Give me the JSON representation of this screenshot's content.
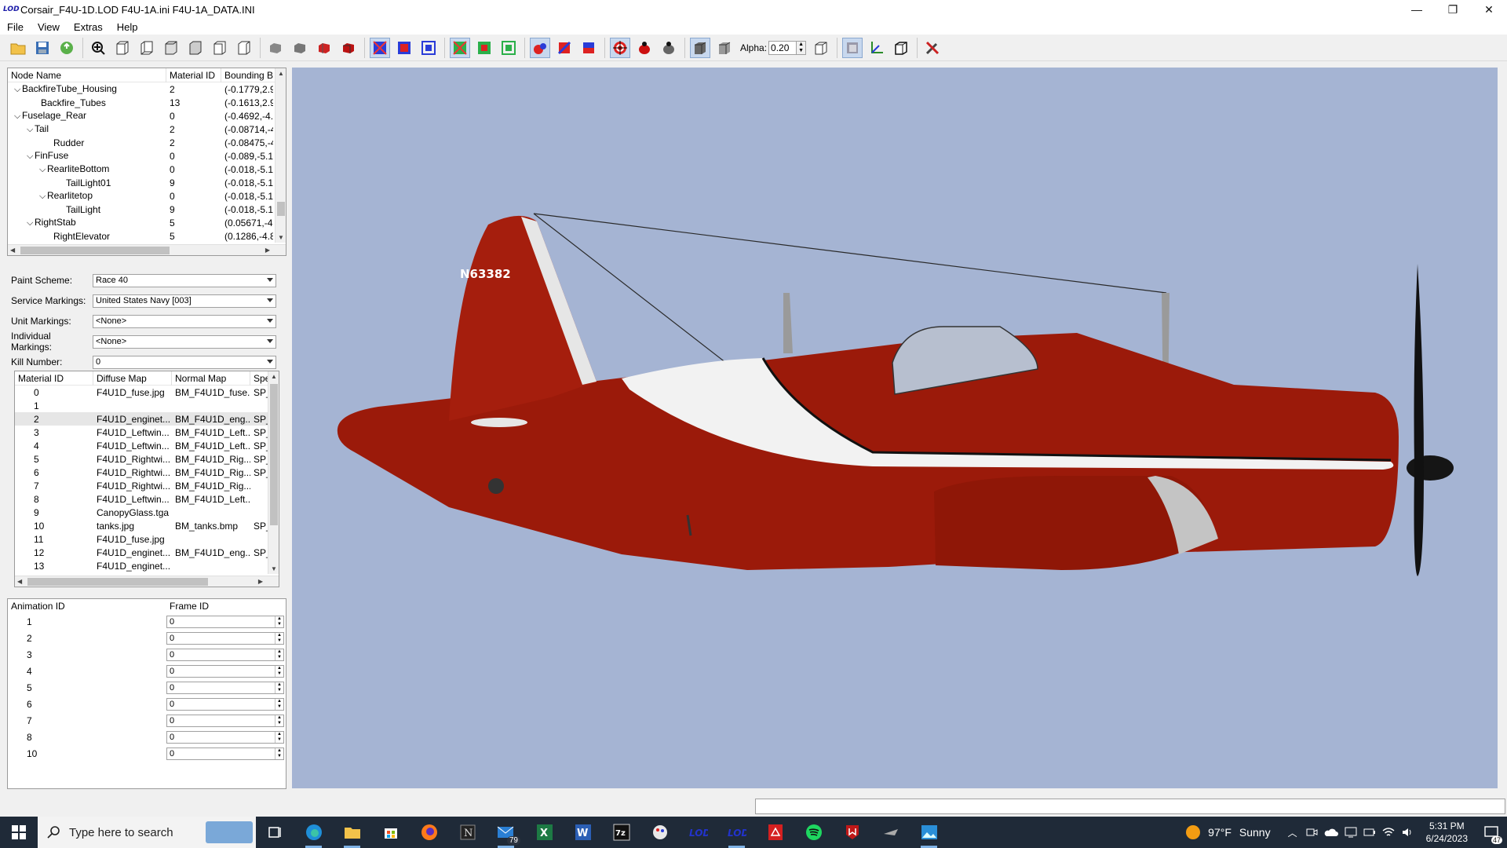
{
  "window": {
    "title": "Corsair_F4U-1D.LOD  F4U-1A.ini  F4U-1A_DATA.INI",
    "logo_text": "LOD",
    "minimize": "—",
    "restore": "❐",
    "close": "✕"
  },
  "menu": [
    "File",
    "View",
    "Extras",
    "Help"
  ],
  "toolbar": {
    "alpha_label": "Alpha:",
    "alpha_value": "0.20"
  },
  "node_tree": {
    "headers": [
      "Node Name",
      "Material ID",
      "Bounding B"
    ],
    "rows": [
      {
        "name": "BackfireTube_Housing",
        "indent": 1,
        "expander": "v",
        "material": "2",
        "bounds": "(-0.1779,2.97"
      },
      {
        "name": "Backfire_Tubes",
        "indent": 2,
        "expander": "",
        "material": "13",
        "bounds": "(-0.1613,2.98"
      },
      {
        "name": "Fuselage_Rear",
        "indent": 1,
        "expander": "v",
        "material": "0",
        "bounds": "(-0.4692,-4.9"
      },
      {
        "name": "Tail",
        "indent": 2,
        "expander": "v",
        "material": "2",
        "bounds": "(-0.08714,-4."
      },
      {
        "name": "Rudder",
        "indent": 3,
        "expander": "",
        "material": "2",
        "bounds": "(-0.08475,-4."
      },
      {
        "name": "FinFuse",
        "indent": 2,
        "expander": "v",
        "material": "0",
        "bounds": "(-0.089,-5.12"
      },
      {
        "name": "RearliteBottom",
        "indent": 3,
        "expander": "v",
        "material": "0",
        "bounds": "(-0.018,-5.12"
      },
      {
        "name": "TailLight01",
        "indent": 4,
        "expander": "",
        "material": "9",
        "bounds": "(-0.018,-5.13"
      },
      {
        "name": "Rearlitetop",
        "indent": 3,
        "expander": "v",
        "material": "0",
        "bounds": "(-0.018,-5.12"
      },
      {
        "name": "TailLight",
        "indent": 4,
        "expander": "",
        "material": "9",
        "bounds": "(-0.018,-5.13"
      },
      {
        "name": "RightStab",
        "indent": 2,
        "expander": "v",
        "material": "5",
        "bounds": "(0.05671,-4.8"
      },
      {
        "name": "RightElevator",
        "indent": 3,
        "expander": "",
        "material": "5",
        "bounds": "(0.1286,-4.80"
      }
    ]
  },
  "markings": {
    "fields": [
      {
        "label": "Paint Scheme:",
        "value": "Race 40"
      },
      {
        "label": "Service Markings:",
        "value": "United States Navy [003]"
      },
      {
        "label": "Unit Markings:",
        "value": "<None>"
      },
      {
        "label": "Individual Markings:",
        "value": "<None>"
      },
      {
        "label": "Kill Number:",
        "value": "0"
      }
    ]
  },
  "materials": {
    "headers": [
      "Material ID",
      "Diffuse Map",
      "Normal Map",
      "Spe"
    ],
    "rows": [
      {
        "id": "0",
        "diffuse": "F4U1D_fuse.jpg",
        "normal": "BM_F4U1D_fuse...",
        "spec": "SP_"
      },
      {
        "id": "1",
        "diffuse": "",
        "normal": "",
        "spec": ""
      },
      {
        "id": "2",
        "diffuse": "F4U1D_enginet...",
        "normal": "BM_F4U1D_eng...",
        "spec": "SP_"
      },
      {
        "id": "3",
        "diffuse": "F4U1D_Leftwin...",
        "normal": "BM_F4U1D_Left...",
        "spec": "SP_"
      },
      {
        "id": "4",
        "diffuse": "F4U1D_Leftwin...",
        "normal": "BM_F4U1D_Left...",
        "spec": "SP_"
      },
      {
        "id": "5",
        "diffuse": "F4U1D_Rightwi...",
        "normal": "BM_F4U1D_Rig...",
        "spec": "SP_"
      },
      {
        "id": "6",
        "diffuse": "F4U1D_Rightwi...",
        "normal": "BM_F4U1D_Rig...",
        "spec": "SP_"
      },
      {
        "id": "7",
        "diffuse": "F4U1D_Rightwi...",
        "normal": "BM_F4U1D_Rig...",
        "spec": ""
      },
      {
        "id": "8",
        "diffuse": "F4U1D_Leftwin...",
        "normal": "BM_F4U1D_Left...",
        "spec": ""
      },
      {
        "id": "9",
        "diffuse": "CanopyGlass.tga",
        "normal": "",
        "spec": ""
      },
      {
        "id": "10",
        "diffuse": "tanks.jpg",
        "normal": "BM_tanks.bmp",
        "spec": "SP_"
      },
      {
        "id": "11",
        "diffuse": "F4U1D_fuse.jpg",
        "normal": "",
        "spec": ""
      },
      {
        "id": "12",
        "diffuse": "F4U1D_enginet...",
        "normal": "BM_F4U1D_eng...",
        "spec": "SP_"
      },
      {
        "id": "13",
        "diffuse": "F4U1D_enginet...",
        "normal": "",
        "spec": ""
      }
    ],
    "selected_id": "2"
  },
  "animations": {
    "headers": [
      "Animation ID",
      "Frame ID"
    ],
    "rows": [
      {
        "id": "1",
        "frame": "0"
      },
      {
        "id": "2",
        "frame": "0"
      },
      {
        "id": "3",
        "frame": "0"
      },
      {
        "id": "4",
        "frame": "0"
      },
      {
        "id": "5",
        "frame": "0"
      },
      {
        "id": "6",
        "frame": "0"
      },
      {
        "id": "7",
        "frame": "0"
      },
      {
        "id": "8",
        "frame": "0"
      },
      {
        "id": "10",
        "frame": "0"
      }
    ]
  },
  "viewport": {
    "background": "#a5b4d3",
    "tail_code": "N63382",
    "aircraft_color": "#9b1a0a",
    "stripe_color": "#f2f2f2"
  },
  "taskbar": {
    "search_placeholder": "Type here to search",
    "mail_badge": "79",
    "weather_temp": "97°F",
    "weather_text": "Sunny",
    "time": "5:31 PM",
    "date": "6/24/2023",
    "notification_count": "47"
  }
}
